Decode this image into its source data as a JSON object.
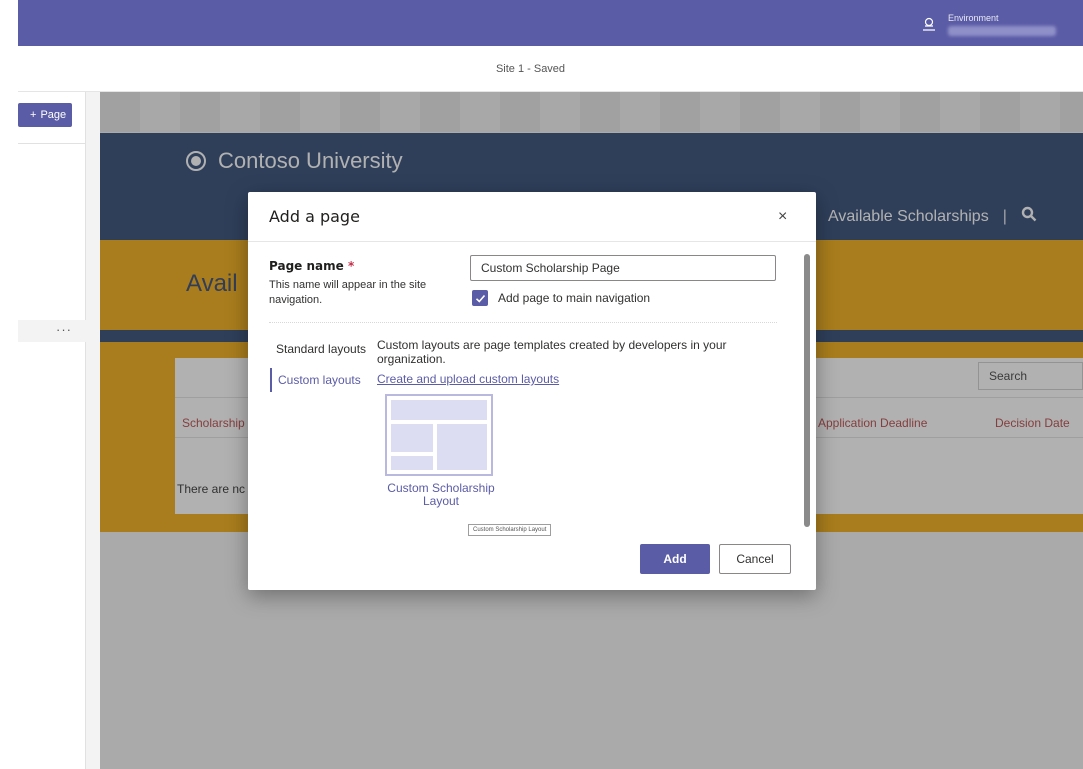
{
  "studio": {
    "environment_label": "Environment",
    "subbar_title": "Site 1 - Saved",
    "page_button": {
      "plus": "+",
      "label": "Page"
    },
    "ellipsis": "···"
  },
  "site": {
    "brand": "Contoso University",
    "nav_link": "Available Scholarships",
    "nav_separator": "|",
    "banner_title": "Avail",
    "search_button": "Search",
    "columns": [
      "Scholarship",
      "Application Deadline",
      "Decision Date"
    ],
    "empty_message": "There are nc"
  },
  "dialog": {
    "title": "Add a page",
    "close": "×",
    "page_name_label": "Page name",
    "required_mark": "*",
    "page_name_help": "This name will appear in the site navigation.",
    "page_name_value": "Custom Scholarship Page",
    "add_to_nav_label": "Add page to main navigation",
    "add_to_nav_checked": true,
    "tabs": [
      "Standard layouts",
      "Custom layouts"
    ],
    "active_tab": "Custom layouts",
    "custom_desc": "Custom layouts are page templates created by developers in your organization.",
    "custom_link": "Create and upload custom layouts",
    "layout_tile_label": "Custom Scholarship Layout",
    "tooltip": "Custom Scholarship Layout",
    "add_button": "Add",
    "cancel_button": "Cancel"
  },
  "colors": {
    "brand": "#5b5ca6",
    "site_header": "#1f3b69",
    "site_banner": "#f1a600"
  },
  "icons": {
    "environment": "environment-icon",
    "logo": "logo-icon",
    "search": "search-icon",
    "close": "close-icon",
    "check": "check-icon"
  }
}
